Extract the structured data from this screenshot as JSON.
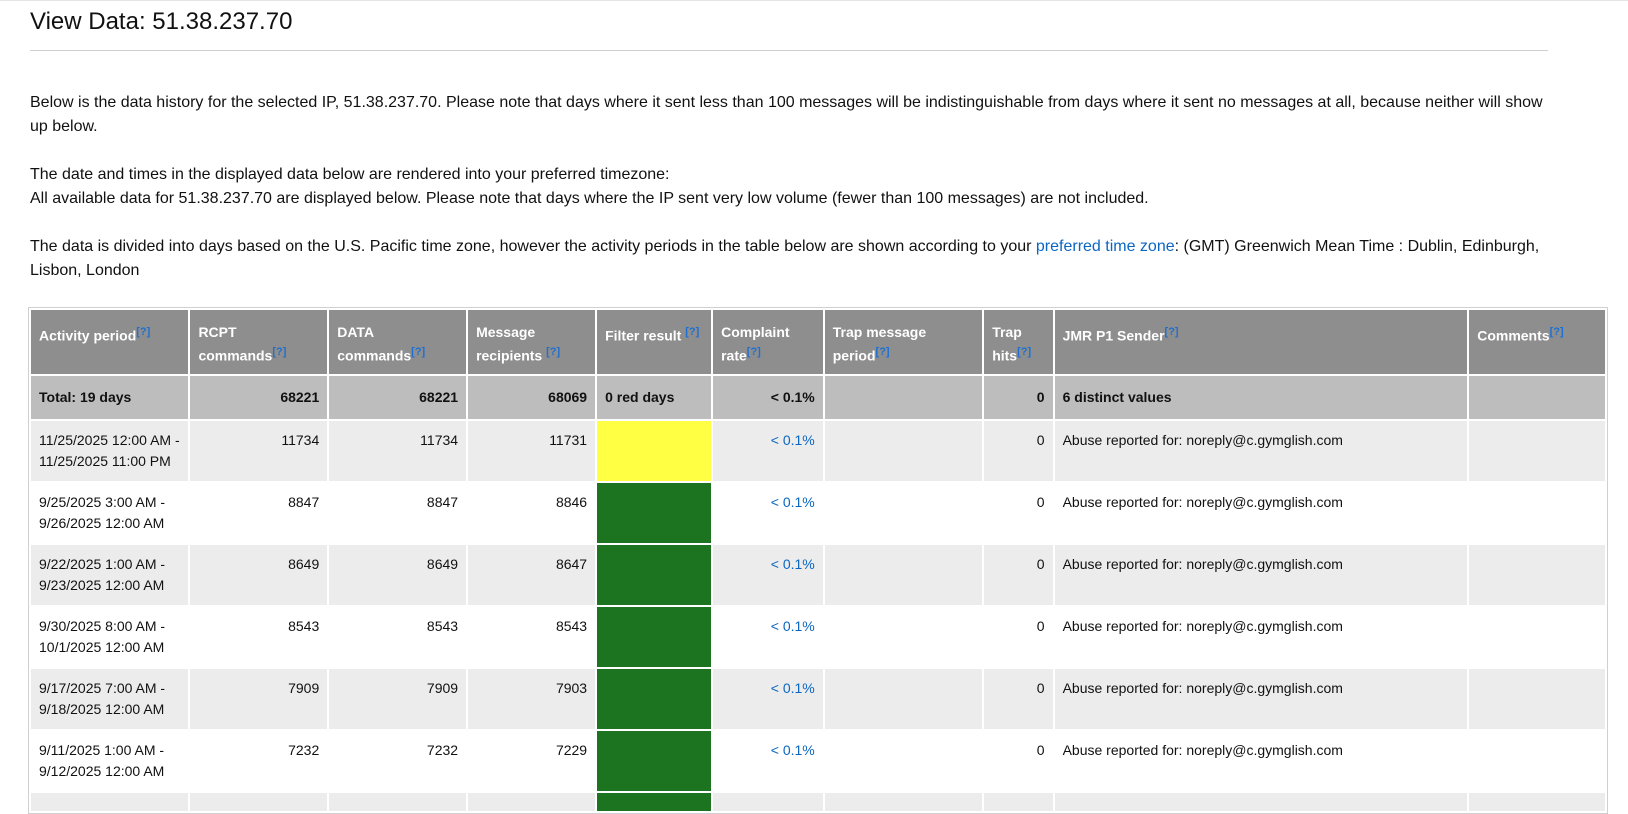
{
  "page": {
    "title": "View Data: 51.38.237.70",
    "intro": "Below is the data history for the selected IP, 51.38.237.70. Please note that days where it sent less than 100 messages will be indistinguishable from days where it sent no messages at all, because neither will show up below.",
    "tz_line1": "The date and times in the displayed data below are rendered into your preferred timezone:",
    "tz_line2": "All available data for 51.38.237.70 are displayed below. Please note that days where the IP sent very low volume (fewer than 100 messages) are not included.",
    "tz_para_pre": "The data is divided into days based on the U.S. Pacific time zone, however the activity periods in the table below are shown according to your ",
    "tz_link": "preferred time zone",
    "tz_para_post": ": (GMT) Greenwich Mean Time : Dublin, Edinburgh, Lisbon, London"
  },
  "table": {
    "help_marker": "[?]",
    "headers": {
      "activity": "Activity period",
      "rcpt": "RCPT commands",
      "data": "DATA commands",
      "recipients": "Message recipients",
      "filter": "Filter result",
      "complaint": "Complaint rate",
      "trap_period": "Trap message period",
      "trap_hits": "Trap hits",
      "jmr": "JMR P1 Sender",
      "comments": "Comments"
    },
    "total": {
      "activity": "Total: 19 days",
      "rcpt": "68221",
      "data": "68221",
      "recipients": "68069",
      "filter": "0 red days",
      "complaint": "< 0.1%",
      "trap_period": "",
      "trap_hits": "0",
      "jmr": "6 distinct values",
      "comments": ""
    },
    "rows": [
      {
        "activity": "11/25/2025 12:00 AM - 11/25/2025 11:00 PM",
        "rcpt": "11734",
        "data": "11734",
        "recipients": "11731",
        "filter_color": "#ffff44",
        "complaint": "< 0.1%",
        "trap_period": "",
        "trap_hits": "0",
        "jmr": "Abuse reported for: noreply@c.gymglish.com",
        "comments": ""
      },
      {
        "activity": "9/25/2025 3:00 AM - 9/26/2025 12:00 AM",
        "rcpt": "8847",
        "data": "8847",
        "recipients": "8846",
        "filter_color": "#1c7320",
        "complaint": "< 0.1%",
        "trap_period": "",
        "trap_hits": "0",
        "jmr": "Abuse reported for: noreply@c.gymglish.com",
        "comments": ""
      },
      {
        "activity": "9/22/2025 1:00 AM - 9/23/2025 12:00 AM",
        "rcpt": "8649",
        "data": "8649",
        "recipients": "8647",
        "filter_color": "#1c7320",
        "complaint": "< 0.1%",
        "trap_period": "",
        "trap_hits": "0",
        "jmr": "Abuse reported for: noreply@c.gymglish.com",
        "comments": ""
      },
      {
        "activity": "9/30/2025 8:00 AM - 10/1/2025 12:00 AM",
        "rcpt": "8543",
        "data": "8543",
        "recipients": "8543",
        "filter_color": "#1c7320",
        "complaint": "< 0.1%",
        "trap_period": "",
        "trap_hits": "0",
        "jmr": "Abuse reported for: noreply@c.gymglish.com",
        "comments": ""
      },
      {
        "activity": "9/17/2025 7:00 AM - 9/18/2025 12:00 AM",
        "rcpt": "7909",
        "data": "7909",
        "recipients": "7903",
        "filter_color": "#1c7320",
        "complaint": "< 0.1%",
        "trap_period": "",
        "trap_hits": "0",
        "jmr": "Abuse reported for: noreply@c.gymglish.com",
        "comments": ""
      },
      {
        "activity": "9/11/2025 1:00 AM - 9/12/2025 12:00 AM",
        "rcpt": "7232",
        "data": "7232",
        "recipients": "7229",
        "filter_color": "#1c7320",
        "complaint": "< 0.1%",
        "trap_period": "",
        "trap_hits": "0",
        "jmr": "Abuse reported for: noreply@c.gymglish.com",
        "comments": ""
      },
      {
        "activity": "",
        "rcpt": "",
        "data": "",
        "recipients": "",
        "filter_color": "#1c7320",
        "complaint": "",
        "trap_period": "",
        "trap_hits": "",
        "jmr": "",
        "comments": ""
      }
    ]
  }
}
